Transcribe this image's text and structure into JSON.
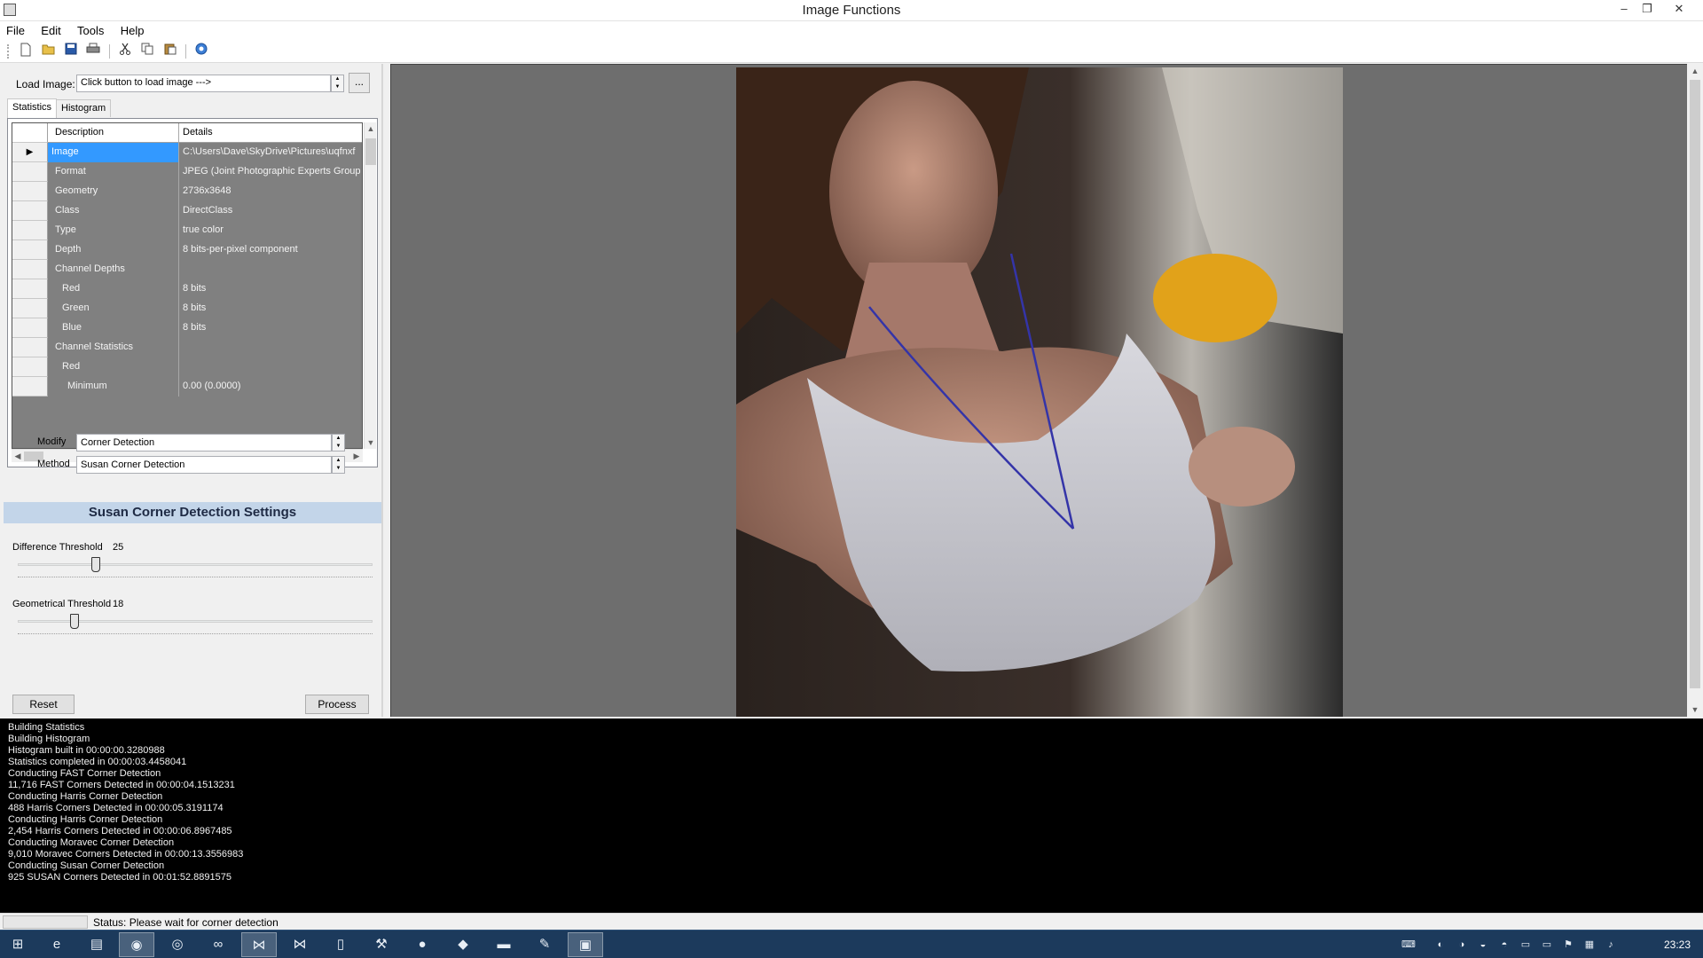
{
  "window": {
    "title": "Image Functions",
    "min_symbol": "–",
    "max_symbol": "❐",
    "close_symbol": "✕"
  },
  "menu": [
    "File",
    "Edit",
    "Tools",
    "Help"
  ],
  "toolbar": {
    "icons": [
      "new-icon",
      "open-icon",
      "save-icon",
      "print-icon",
      "cut-icon",
      "copy-icon",
      "paste-icon",
      "help-icon"
    ]
  },
  "load": {
    "label": "Load Image:",
    "value": "Click button to load image --->",
    "browse_label": "..."
  },
  "tabs": [
    "Statistics",
    "Histogram"
  ],
  "grid": {
    "columns": [
      "Description",
      "Details"
    ],
    "rows": [
      {
        "desc": "Image",
        "detail": "C:\\Users\\Dave\\SkyDrive\\Pictures\\uqfnxf",
        "indent": 0,
        "selected": true
      },
      {
        "desc": "Format",
        "detail": "JPEG (Joint Photographic Experts Group J",
        "indent": 1
      },
      {
        "desc": "Geometry",
        "detail": "2736x3648",
        "indent": 1
      },
      {
        "desc": "Class",
        "detail": "DirectClass",
        "indent": 1
      },
      {
        "desc": "Type",
        "detail": "true color",
        "indent": 1
      },
      {
        "desc": "Depth",
        "detail": "8 bits-per-pixel component",
        "indent": 1
      },
      {
        "desc": "Channel Depths",
        "detail": "",
        "indent": 1
      },
      {
        "desc": "Red",
        "detail": "8 bits",
        "indent": 2
      },
      {
        "desc": "Green",
        "detail": "8 bits",
        "indent": 2
      },
      {
        "desc": "Blue",
        "detail": "8 bits",
        "indent": 2
      },
      {
        "desc": "Channel Statistics",
        "detail": "",
        "indent": 1
      },
      {
        "desc": "Red",
        "detail": "",
        "indent": 2
      },
      {
        "desc": "Minimum",
        "detail": "0.00 (0.0000)",
        "indent": 3
      }
    ]
  },
  "modify": {
    "modify_label": "Modify",
    "modify_value": "Corner Detection",
    "method_label": "Method",
    "method_value": "Susan Corner Detection"
  },
  "settings": {
    "title": "Susan Corner Detection Settings",
    "difference_label": "Difference Threshold",
    "difference_value": "25",
    "geometrical_label": "Geometrical Threshold",
    "geometrical_value": "18",
    "difference_fraction": 0.22,
    "geometrical_fraction": 0.16
  },
  "buttons": {
    "reset": "Reset",
    "process": "Process"
  },
  "log": [
    "Building Statistics",
    "Building Histogram",
    "Histogram built in 00:00:00.3280988",
    "Statistics completed in 00:00:03.4458041",
    "Conducting FAST Corner Detection",
    "11,716 FAST Corners Detected in 00:00:04.1513231",
    "Conducting Harris Corner Detection",
    "488 Harris Corners Detected in 00:00:05.3191174",
    "Conducting Harris Corner Detection",
    "2,454 Harris Corners Detected in 00:00:06.8967485",
    "Conducting Moravec Corner Detection",
    "9,010 Moravec Corners Detected in 00:00:13.3556983",
    "Conducting Susan Corner Detection",
    "925 SUSAN Corners Detected in 00:01:52.8891575"
  ],
  "status": {
    "text": "Status:  Please wait for corner detection"
  },
  "taskbar": {
    "clock": "23:23",
    "apps": [
      "start",
      "internet-explorer",
      "file-explorer",
      "firefox",
      "app",
      "app",
      "visual-studio",
      "visual-studio",
      "notepad",
      "app",
      "app",
      "app",
      "app",
      "app",
      "image-functions"
    ]
  },
  "colors": {
    "selection": "#3399ff",
    "grid_background": "#808080",
    "settings_header": "#c3d5e9",
    "console_background": "#000000",
    "taskbar": "#1c3a5c"
  }
}
